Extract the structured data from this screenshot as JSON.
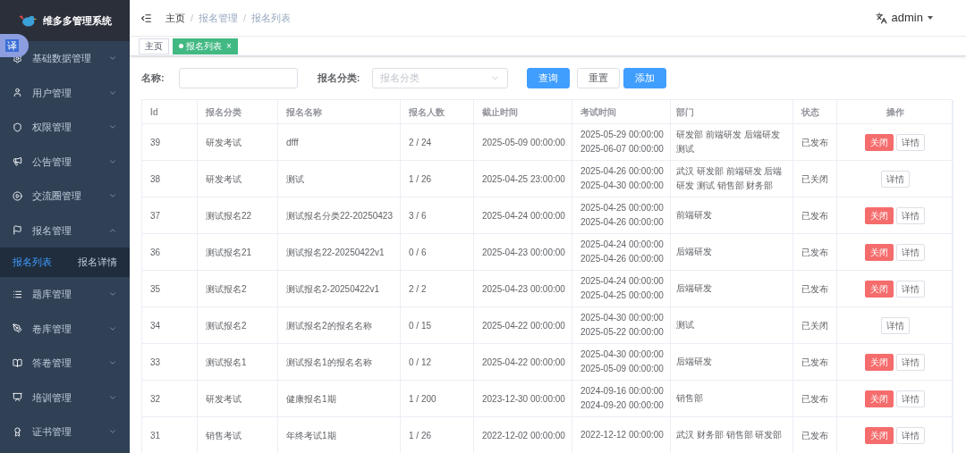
{
  "app": {
    "title": "维多多管理系统"
  },
  "translate_badge": "译",
  "sidebar": {
    "items": [
      {
        "label": "基础数据管理",
        "expanded": false
      },
      {
        "label": "用户管理",
        "expanded": false
      },
      {
        "label": "权限管理",
        "expanded": false
      },
      {
        "label": "公告管理",
        "expanded": false
      },
      {
        "label": "交流圈管理",
        "expanded": false
      },
      {
        "label": "报名管理",
        "expanded": true,
        "children": [
          {
            "label": "报名列表",
            "selected": true
          },
          {
            "label": "报名详情",
            "selected": false
          }
        ]
      },
      {
        "label": "题库管理",
        "expanded": false
      },
      {
        "label": "卷库管理",
        "expanded": false
      },
      {
        "label": "答卷管理",
        "expanded": false
      },
      {
        "label": "培训管理",
        "expanded": false
      },
      {
        "label": "证书管理",
        "expanded": false
      }
    ]
  },
  "breadcrumb": [
    {
      "label": "主页",
      "kind": "link"
    },
    {
      "label": "/",
      "kind": "separator"
    },
    {
      "label": "报名管理",
      "kind": "link"
    },
    {
      "label": "/",
      "kind": "separator"
    },
    {
      "label": "报名列表",
      "kind": "current"
    }
  ],
  "user": {
    "name": "admin"
  },
  "tags": [
    {
      "label": "主页",
      "selected": false
    },
    {
      "label": "报名列表",
      "selected": true,
      "close": "×"
    }
  ],
  "filters": {
    "name_label": "名称:",
    "category_label": "报名分类:",
    "category_placeholder": "报名分类",
    "buttons": [
      {
        "label": "查询",
        "kind": "primary"
      },
      {
        "label": "重置",
        "kind": "default"
      },
      {
        "label": "添加",
        "kind": "primary"
      }
    ]
  },
  "table": {
    "columns": [
      "Id",
      "报名分类",
      "报名名称",
      "报名人数",
      "截止时间",
      "考试时间",
      "部门",
      "状态",
      "操作"
    ],
    "rows": [
      {
        "id": "39",
        "category": "研发考试",
        "name": "dfff",
        "count": "2 / 24",
        "deadline": "2025-05-09 00:00:00",
        "exam_time": [
          "2025-05-29 00:00:00",
          "2025-06-07 00:00:00"
        ],
        "department": [
          "研发部 前端研发 后端研发",
          "测试"
        ],
        "status": "已发布",
        "actions": [
          {
            "label": "关闭",
            "kind": "danger"
          },
          {
            "label": "详情",
            "kind": "default"
          }
        ]
      },
      {
        "id": "38",
        "category": "研发考试",
        "name": "测试",
        "count": "1 / 26",
        "deadline": "2025-04-25 23:00:00",
        "exam_time": [
          "2025-04-26 00:00:00",
          "2025-04-30 00:00:00"
        ],
        "department": [
          "武汉 研发部 前端研发 后端",
          "研发 测试 销售部 财务部"
        ],
        "status": "已关闭",
        "actions": [
          {
            "label": "详情",
            "kind": "default"
          }
        ]
      },
      {
        "id": "37",
        "category": "测试报名22",
        "name": "测试报名分类22-20250423",
        "count": "3 / 6",
        "deadline": "2025-04-24 00:00:00",
        "exam_time": [
          "2025-04-25 00:00:00",
          "2025-04-26 00:00:00"
        ],
        "department": [
          "前端研发"
        ],
        "status": "已发布",
        "actions": [
          {
            "label": "关闭",
            "kind": "danger"
          },
          {
            "label": "详情",
            "kind": "default"
          }
        ]
      },
      {
        "id": "36",
        "category": "测试报名21",
        "name": "测试报名22-20250422v1",
        "count": "0 / 6",
        "deadline": "2025-04-23 00:00:00",
        "exam_time": [
          "2025-04-24 00:00:00",
          "2025-04-26 00:00:00"
        ],
        "department": [
          "后端研发"
        ],
        "status": "已发布",
        "actions": [
          {
            "label": "关闭",
            "kind": "danger"
          },
          {
            "label": "详情",
            "kind": "default"
          }
        ]
      },
      {
        "id": "35",
        "category": "测试报名2",
        "name": "测试报名2-20250422v1",
        "count": "2 / 2",
        "deadline": "2025-04-23 00:00:00",
        "exam_time": [
          "2025-04-24 00:00:00",
          "2025-04-25 00:00:00"
        ],
        "department": [
          "后端研发"
        ],
        "status": "已发布",
        "actions": [
          {
            "label": "关闭",
            "kind": "danger"
          },
          {
            "label": "详情",
            "kind": "default"
          }
        ]
      },
      {
        "id": "34",
        "category": "测试报名2",
        "name": "测试报名2的报名名称",
        "count": "0 / 15",
        "deadline": "2025-04-22 00:00:00",
        "exam_time": [
          "2025-04-30 00:00:00",
          "2025-05-22 00:00:00"
        ],
        "department": [
          "测试"
        ],
        "status": "已关闭",
        "actions": [
          {
            "label": "详情",
            "kind": "default"
          }
        ]
      },
      {
        "id": "33",
        "category": "测试报名1",
        "name": "测试报名1的报名名称",
        "count": "0 / 12",
        "deadline": "2025-04-22 00:00:00",
        "exam_time": [
          "2025-04-30 00:00:00",
          "2025-05-09 00:00:00"
        ],
        "department": [
          "后端研发"
        ],
        "status": "已发布",
        "actions": [
          {
            "label": "关闭",
            "kind": "danger"
          },
          {
            "label": "详情",
            "kind": "default"
          }
        ]
      },
      {
        "id": "32",
        "category": "研发考试",
        "name": "健康报名1期",
        "count": "1 / 200",
        "deadline": "2023-12-30 00:00:00",
        "exam_time": [
          "2024-09-16 00:00:00",
          "2024-09-20 00:00:00"
        ],
        "department": [
          "销售部"
        ],
        "status": "已发布",
        "actions": [
          {
            "label": "关闭",
            "kind": "danger"
          },
          {
            "label": "详情",
            "kind": "default"
          }
        ]
      },
      {
        "id": "31",
        "category": "销售考试",
        "name": "年终考试1期",
        "count": "1 / 26",
        "deadline": "2022-12-02 00:00:00",
        "exam_time": [
          "2022-12-12 00:00:00"
        ],
        "department": [
          "武汉 财务部 销售部 研发部"
        ],
        "status": "已发布",
        "actions": [
          {
            "label": "关闭",
            "kind": "danger"
          },
          {
            "label": "详情",
            "kind": "default"
          }
        ]
      }
    ]
  }
}
